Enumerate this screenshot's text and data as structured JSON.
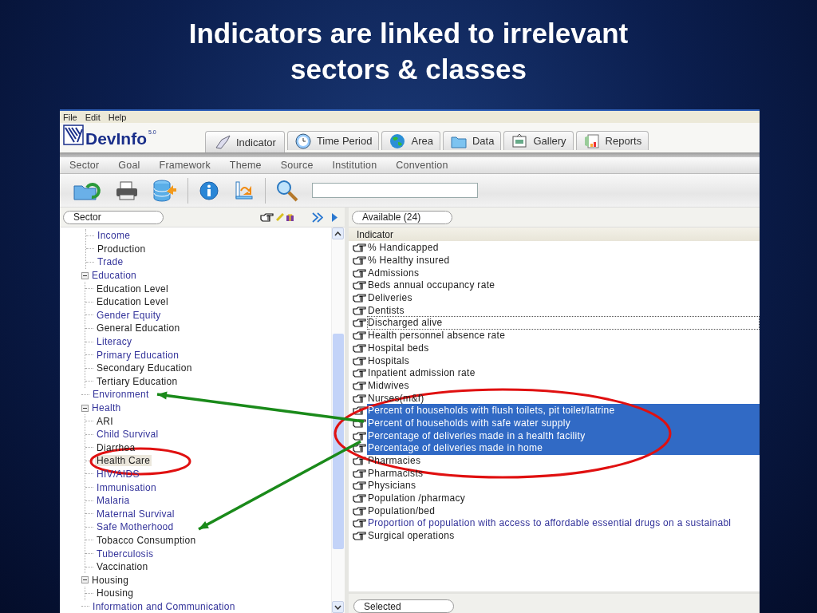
{
  "slide": {
    "title": "Indicators are linked to irrelevant sectors & classes"
  },
  "window": {
    "menu": [
      "File",
      "Edit",
      "Help"
    ],
    "logo": {
      "name": "DevInfo",
      "version": "5.0"
    },
    "tabs": [
      {
        "label": "Indicator",
        "selected": true
      },
      {
        "label": "Time Period",
        "selected": false
      },
      {
        "label": "Area",
        "selected": false
      },
      {
        "label": "Data",
        "selected": false
      },
      {
        "label": "Gallery",
        "selected": false
      },
      {
        "label": "Reports",
        "selected": false
      }
    ],
    "subtabs": [
      "Sector",
      "Goal",
      "Framework",
      "Theme",
      "Source",
      "Institution",
      "Convention"
    ],
    "sector_panel": {
      "dropdown": "Sector",
      "tree": [
        {
          "children": [
            {
              "label": "Income",
              "color": "#33339a",
              "selected": false
            },
            {
              "label": "Production",
              "color": "#222222",
              "selected": false
            },
            {
              "label": "Trade",
              "color": "#33339a",
              "selected": false
            }
          ]
        },
        {
          "label": "Education",
          "color": "#33339a",
          "selected": false,
          "expanded": true,
          "children": [
            {
              "label": "Education Level",
              "color": "#222222",
              "selected": false
            },
            {
              "label": "Education Level",
              "color": "#222222",
              "selected": false
            },
            {
              "label": "Gender Equity",
              "color": "#33339a",
              "selected": false
            },
            {
              "label": "General Education",
              "color": "#222222",
              "selected": false
            },
            {
              "label": "Literacy",
              "color": "#33339a",
              "selected": false
            },
            {
              "label": "Primary Education",
              "color": "#33339a",
              "selected": false
            },
            {
              "label": "Secondary Education",
              "color": "#222222",
              "selected": false
            },
            {
              "label": "Tertiary Education",
              "color": "#222222",
              "selected": false
            }
          ]
        },
        {
          "label": "Environment",
          "color": "#33339a",
          "selected": false
        },
        {
          "label": "Health",
          "color": "#33339a",
          "selected": false,
          "expanded": true,
          "children": [
            {
              "label": "ARI",
              "color": "#222222",
              "selected": false
            },
            {
              "label": "Child Survival",
              "color": "#33339a",
              "selected": false
            },
            {
              "label": "Diarrhea",
              "color": "#222222",
              "selected": false
            },
            {
              "label": "Health Care",
              "color": "#222222",
              "selected": true
            },
            {
              "label": "HIV/AIDS",
              "color": "#33339a",
              "selected": false
            },
            {
              "label": "Immunisation",
              "color": "#33339a",
              "selected": false
            },
            {
              "label": "Malaria",
              "color": "#33339a",
              "selected": false
            },
            {
              "label": "Maternal Survival",
              "color": "#33339a",
              "selected": false
            },
            {
              "label": "Safe Motherhood",
              "color": "#33339a",
              "selected": false
            },
            {
              "label": "Tobacco Consumption",
              "color": "#222222",
              "selected": false
            },
            {
              "label": "Tuberculosis",
              "color": "#33339a",
              "selected": false
            },
            {
              "label": "Vaccination",
              "color": "#222222",
              "selected": false
            }
          ]
        },
        {
          "label": "Housing",
          "color": "#222222",
          "selected": false,
          "expanded": true,
          "children": [
            {
              "label": "Housing",
              "color": "#222222",
              "selected": false
            }
          ]
        },
        {
          "label": "Information and Communication",
          "color": "#33339a",
          "selected": false
        }
      ]
    },
    "indicator_panel": {
      "dropdown": "Available (24)",
      "column": "Indicator",
      "selected_dropdown": "Selected",
      "items": [
        {
          "label": "% Handicapped",
          "color": "#222222",
          "selected": false,
          "focused": false
        },
        {
          "label": "% Healthy insured",
          "color": "#222222",
          "selected": false,
          "focused": false
        },
        {
          "label": "Admissions",
          "color": "#222222",
          "selected": false,
          "focused": false
        },
        {
          "label": "Beds annual occupancy rate",
          "color": "#222222",
          "selected": false,
          "focused": false
        },
        {
          "label": "Deliveries",
          "color": "#222222",
          "selected": false,
          "focused": false
        },
        {
          "label": "Dentists",
          "color": "#222222",
          "selected": false,
          "focused": false
        },
        {
          "label": "Discharged alive",
          "color": "#222222",
          "selected": false,
          "focused": true
        },
        {
          "label": "Health personnel absence rate",
          "color": "#222222",
          "selected": false,
          "focused": false
        },
        {
          "label": "Hospital beds",
          "color": "#222222",
          "selected": false,
          "focused": false
        },
        {
          "label": "Hospitals",
          "color": "#222222",
          "selected": false,
          "focused": false
        },
        {
          "label": "Inpatient admission rate",
          "color": "#222222",
          "selected": false,
          "focused": false
        },
        {
          "label": "Midwives",
          "color": "#222222",
          "selected": false,
          "focused": false
        },
        {
          "label": "Nurses(m&f)",
          "color": "#222222",
          "selected": false,
          "focused": false
        },
        {
          "label": "Percent of households with flush toilets, pit toilet/latrine",
          "selected": true,
          "focused": false
        },
        {
          "label": "Percent of households with safe water supply",
          "selected": true,
          "focused": false
        },
        {
          "label": "Percentage of deliveries made in a health facility",
          "selected": true,
          "focused": false
        },
        {
          "label": "Percentage of deliveries made in home",
          "selected": true,
          "focused": false
        },
        {
          "label": "Pharmacies",
          "color": "#222222",
          "selected": false,
          "focused": false
        },
        {
          "label": "Pharmacists",
          "color": "#222222",
          "selected": false,
          "focused": false
        },
        {
          "label": "Physicians",
          "color": "#222222",
          "selected": false,
          "focused": false
        },
        {
          "label": "Population /pharmacy",
          "color": "#222222",
          "selected": false,
          "focused": false
        },
        {
          "label": "Population/bed",
          "color": "#222222",
          "selected": false,
          "focused": false
        },
        {
          "label": "Proportion of population with access to affordable essential drugs on a sustainabl",
          "color": "#33339a",
          "selected": false,
          "focused": false
        },
        {
          "label": "Surgical operations",
          "color": "#222222",
          "selected": false,
          "focused": false
        }
      ]
    }
  },
  "annotations": [
    {
      "kind": "ellipse",
      "color": "#e01010"
    },
    {
      "kind": "ellipse",
      "color": "#e01010"
    },
    {
      "kind": "arrow",
      "color": "#1a8a1a"
    },
    {
      "kind": "arrow",
      "color": "#1a8a1a"
    }
  ]
}
